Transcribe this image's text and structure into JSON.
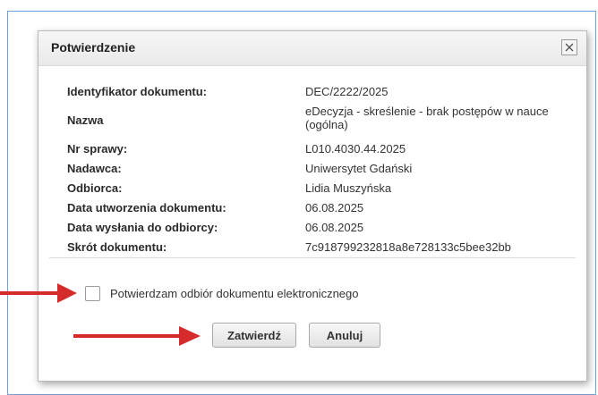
{
  "dialog": {
    "title": "Potwierdzenie",
    "close_icon": "close-icon"
  },
  "fields": [
    {
      "label": "Identyfikator dokumentu:",
      "value": "DEC/2222/2025"
    },
    {
      "label": "Nazwa",
      "value": "eDecyzja - skreślenie - brak postępów w nauce (ogólna)"
    },
    {
      "label": "Nr sprawy:",
      "value": "L010.4030.44.2025"
    },
    {
      "label": "Nadawca:",
      "value": "Uniwersytet Gdański"
    },
    {
      "label": "Odbiorca:",
      "value": "Lidia Muszyńska"
    },
    {
      "label": "Data utworzenia dokumentu:",
      "value": "06.08.2025"
    },
    {
      "label": "Data wysłania do odbiorcy:",
      "value": "06.08.2025"
    },
    {
      "label": "Skrót dokumentu:",
      "value": "7c918799232818a8e728133c5bee32bb"
    }
  ],
  "confirm": {
    "label": "Potwierdzam odbiór dokumentu elektronicznego",
    "checked": false
  },
  "buttons": {
    "confirm_label": "Zatwierdź",
    "cancel_label": "Anuluj"
  },
  "colors": {
    "arrow": "#d62b2b",
    "frame": "#6fa3d8"
  }
}
